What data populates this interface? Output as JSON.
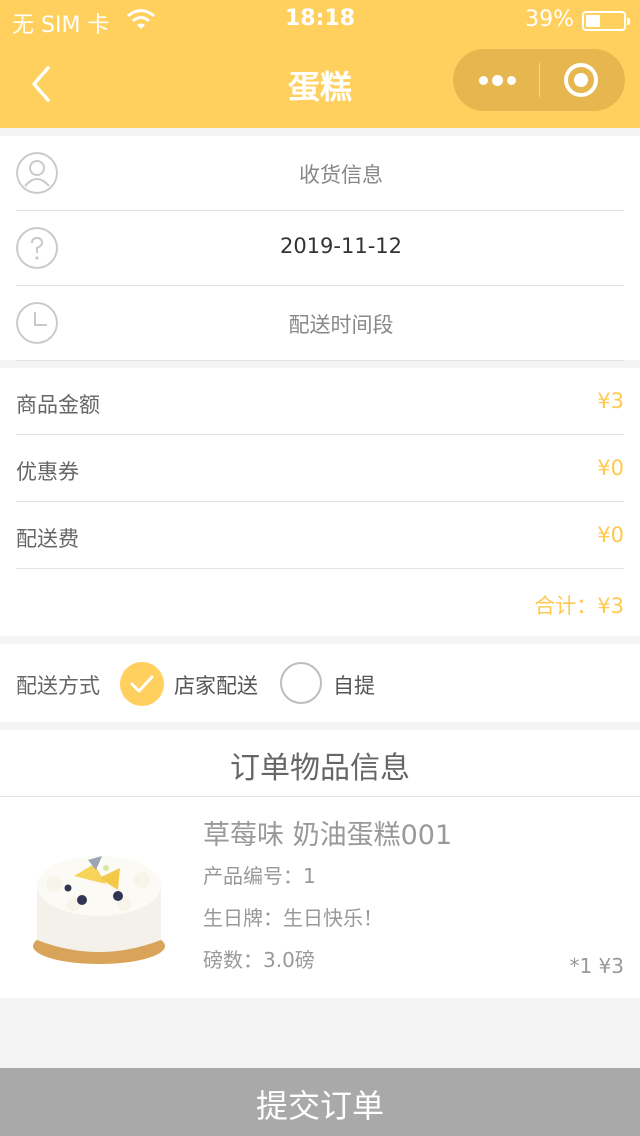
{
  "status_bar": {
    "carrier": "无 SIM 卡",
    "time": "18:18",
    "battery": "39%"
  },
  "nav": {
    "title": "蛋糕"
  },
  "delivery_info": {
    "receiver_label": "收货信息",
    "date": "2019-11-12",
    "time_slot_label": "配送时间段"
  },
  "pricing": {
    "rows": [
      {
        "label": "商品金额",
        "value": "¥3"
      },
      {
        "label": "优惠券",
        "value": "¥0"
      },
      {
        "label": "配送费",
        "value": "¥0"
      }
    ],
    "total": "合计：¥3"
  },
  "delivery_method": {
    "label": "配送方式",
    "options": [
      {
        "label": "店家配送",
        "selected": true
      },
      {
        "label": "自提",
        "selected": false
      }
    ]
  },
  "order_items": {
    "title": "订单物品信息",
    "item": {
      "name": "草莓味 奶油蛋糕001",
      "product_no": "产品编号：1",
      "birthday_card": "生日牌：生日快乐！",
      "weight": "磅数：3.0磅",
      "qty_price": "*1   ¥3"
    }
  },
  "submit_label": "提交订单",
  "colors": {
    "accent": "#ffd05e",
    "price": "#ffc94d",
    "submit_bg": "#a9a9a9"
  }
}
